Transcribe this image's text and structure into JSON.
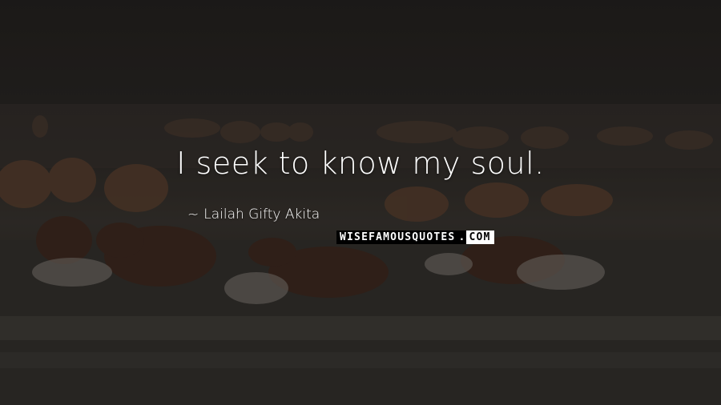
{
  "quote": {
    "text": "I seek to know my soul.",
    "author": "Lailah Gifty Akita",
    "author_prefix": "~"
  },
  "watermark": {
    "main": "WISEFAMOUSQUOTES",
    "dot": ".",
    "tld": "COM"
  },
  "colors": {
    "text": "#ffffff",
    "background": "#2a2724",
    "water_splash": "#8a8580"
  }
}
